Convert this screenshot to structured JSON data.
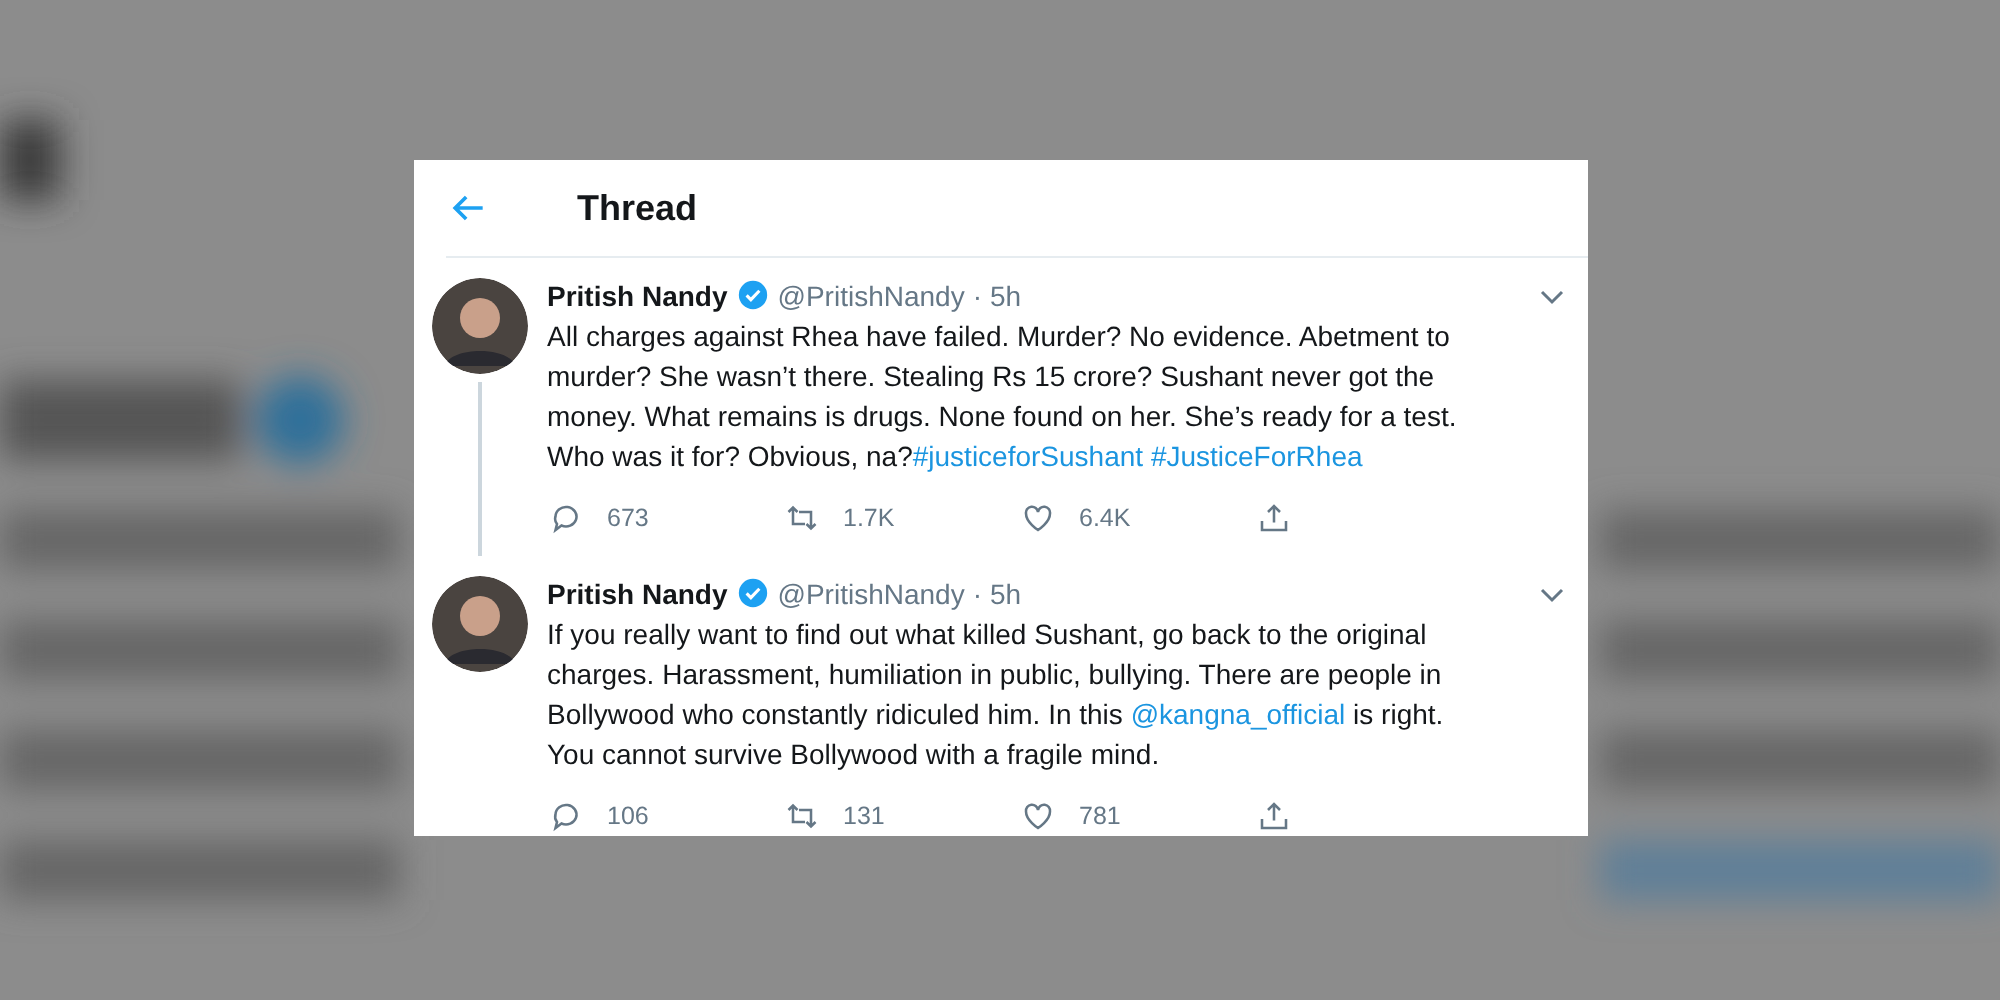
{
  "header": {
    "title": "Thread"
  },
  "tweets": [
    {
      "name": "Pritish Nandy",
      "verified": true,
      "handle": "@PritishNandy",
      "separator": "·",
      "time": "5h",
      "thread_continues": true,
      "body": [
        {
          "kind": "plain",
          "text": "All charges against Rhea have failed. Murder? No evidence. Abetment to murder? She wasn’t there. Stealing Rs 15 crore? Sushant never got the money. What remains is drugs. None found on her. She’s ready for a test. Who was it for? Obvious, na?"
        },
        {
          "kind": "link",
          "text": "#justiceforSushant"
        },
        {
          "kind": "link",
          "text": "#JusticeForRhea",
          "space_before": true
        }
      ],
      "replies": "673",
      "retweets": "1.7K",
      "likes": "6.4K"
    },
    {
      "name": "Pritish Nandy",
      "verified": true,
      "handle": "@PritishNandy",
      "separator": "·",
      "time": "5h",
      "thread_continues": false,
      "body": [
        {
          "kind": "plain",
          "text": "If you really want to find out what killed Sushant, go back to the original charges. Harassment, humiliation in public, bullying. There are people in Bollywood who constantly ridiculed him. In this "
        },
        {
          "kind": "link",
          "text": "@kangna_official"
        },
        {
          "kind": "plain",
          "text": " is right. You cannot survive Bollywood with a fragile mind."
        }
      ],
      "replies": "106",
      "retweets": "131",
      "likes": "781"
    }
  ]
}
